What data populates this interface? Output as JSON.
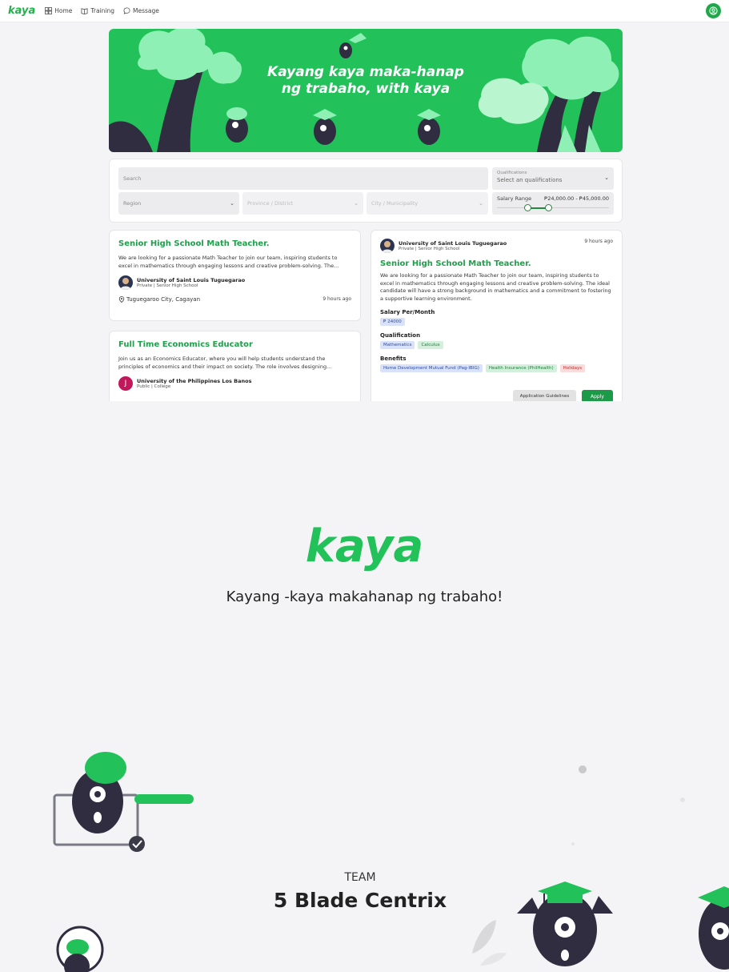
{
  "nav": {
    "logo": "kaya",
    "items": [
      {
        "label": "Home",
        "icon": "grid-icon"
      },
      {
        "label": "Training",
        "icon": "book-icon"
      },
      {
        "label": "Message",
        "icon": "chat-icon"
      }
    ],
    "avatar_icon": "user-circle-icon"
  },
  "hero": {
    "line1": "Kayang kaya maka-hanap",
    "line2": "ng trabaho, with kaya"
  },
  "filters": {
    "search_placeholder": "Search",
    "qualifications_label": "Qualifications",
    "qualifications_value": "Select an qualifications",
    "region": "Region",
    "province": "Province / District",
    "city": "City / Municipality",
    "salary_label": "Salary Range",
    "salary_range": "₱24,000.00 - ₱45,000.00",
    "salary_min_fraction": 0.27,
    "salary_max_fraction": 0.46
  },
  "jobs": [
    {
      "title": "Senior High School Math Teacher.",
      "desc": "We are looking for a passionate Math Teacher to join our team, inspiring students to excel in mathematics through engaging lessons and creative problem-solving. The...",
      "org": "University of Saint Louis Tuguegarao",
      "org_type": "Private | Senior High School",
      "location": "Tuguegaroo City, Cagayan",
      "time": "9 hours ago"
    },
    {
      "title": "Full Time Economics Educator",
      "desc": "Join us as an Economics Educator, where you will help students understand the principles of economics and their impact on society. The role involves designing...",
      "org": "University of the Philippines Los Banos",
      "org_type": "Public | College",
      "org_initial": "J"
    }
  ],
  "detail": {
    "org": "University of Saint Louis Tuguegarao",
    "org_type": "Private | Senior High School",
    "time": "9 hours ago",
    "title": "Senior High School Math Teacher.",
    "desc": "We are looking for a passionate Math Teacher to join our team, inspiring students to excel in mathematics through engaging lessons and creative problem-solving. The ideal candidate will have a strong background in mathematics and a commitment to fostering a supportive learning environment.",
    "salary_label": "Salary Per/Month",
    "salary": "₱ 24000",
    "qual_label": "Qualification",
    "quals": [
      "Mathematics",
      "Calculus"
    ],
    "benefits_label": "Benefits",
    "benefits": [
      "Home Development Mutual Fund (Pag-IBIG)",
      "Health Insurance (PhilHealth)",
      "Holidays"
    ],
    "btn_guidelines": "Application Guidelines",
    "btn_apply": "Apply"
  },
  "splash": {
    "logo": "kaya",
    "tagline": "Kayang -kaya makahanap ng trabaho!",
    "team_label": "TEAM",
    "team_name": "5 Blade Centrix"
  },
  "colors": {
    "brand": "#22c15a",
    "dark": "#2f2d3f"
  }
}
